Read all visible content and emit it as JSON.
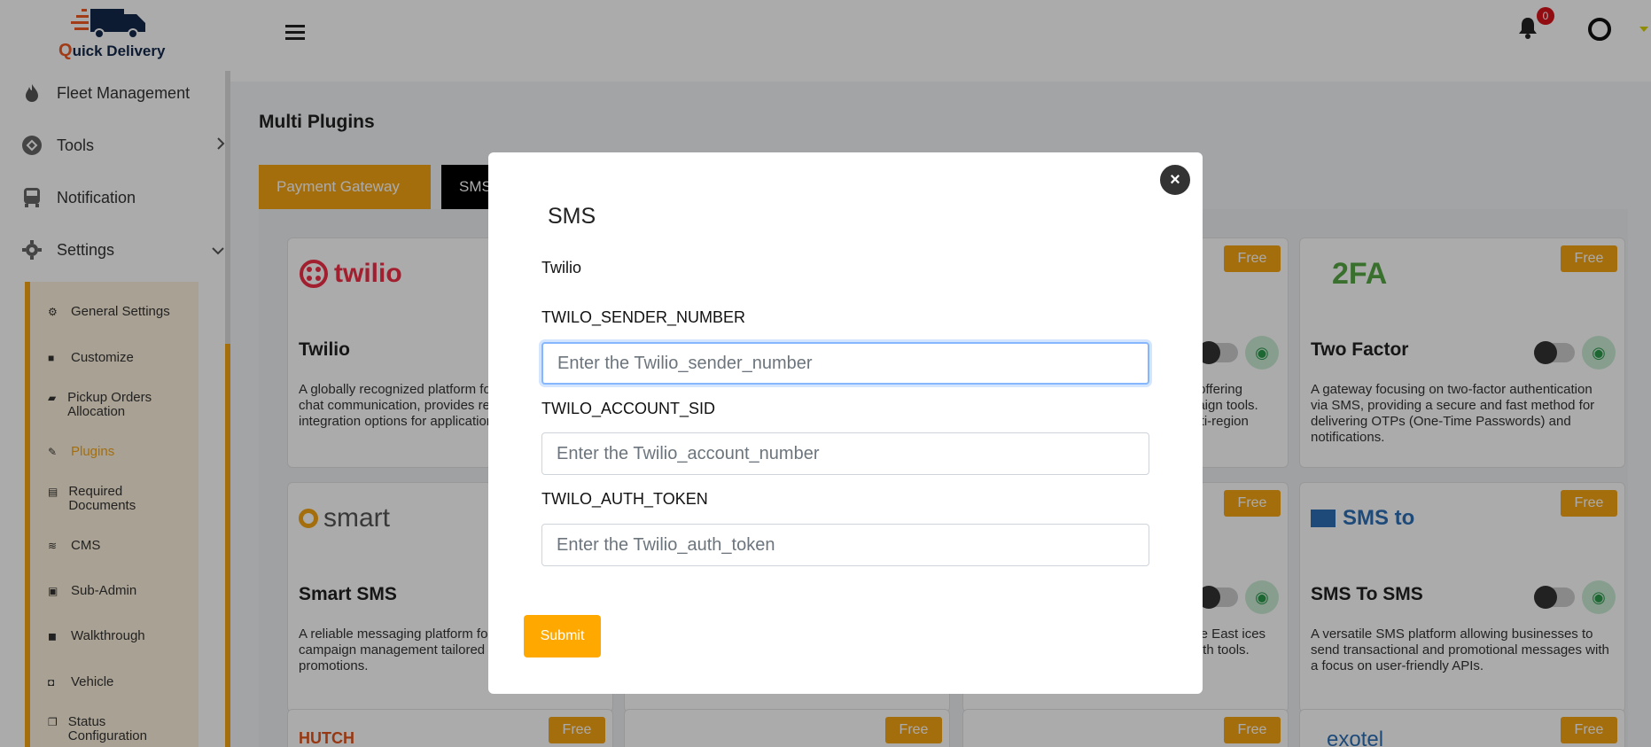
{
  "app": {
    "logo_name_initial": "Q",
    "logo_name_rest": "uick Delivery"
  },
  "sidebar": {
    "items": [
      {
        "label": "Fleet Management",
        "icon": "flame-icon"
      },
      {
        "label": "Tools",
        "icon": "tools-icon"
      },
      {
        "label": "Notification",
        "icon": "bus-icon"
      },
      {
        "label": "Settings",
        "icon": "gear-icon"
      }
    ],
    "submenu": [
      {
        "label": "General Settings",
        "icon": "gear-icon"
      },
      {
        "label": "Customize",
        "icon": "box-icon"
      },
      {
        "label": "Pickup Orders Allocation",
        "icon": "book-icon"
      },
      {
        "label": "Plugins",
        "icon": "plug-icon",
        "active": true
      },
      {
        "label": "Required Documents",
        "icon": "document-icon"
      },
      {
        "label": "CMS",
        "icon": "layers-icon"
      },
      {
        "label": "Sub-Admin",
        "icon": "id-card-icon"
      },
      {
        "label": "Walkthrough",
        "icon": "briefcase-icon"
      },
      {
        "label": "Vehicle",
        "icon": "bus-icon"
      },
      {
        "label": "Status Configuration",
        "icon": "copy-icon"
      }
    ]
  },
  "topbar": {
    "notification_count": "0"
  },
  "main": {
    "title": "Multi Plugins",
    "tabs": [
      {
        "label": "Payment Gateway"
      },
      {
        "label": "SMS"
      }
    ],
    "free_label": "Free",
    "cards": [
      {
        "brand": "twilio",
        "name": "Twilio",
        "desc": "A globally recognized platform for SMS, voice, and chat communication, provides reliable delivery and integration options for applications."
      },
      {
        "desc": "r offering paign tools. ulti-region"
      },
      {
        "brand": "2FA",
        "name": "Two Factor",
        "desc": "A gateway focusing on two-factor authentication via SMS, providing a secure and fast method for delivering OTPs (One-Time Passwords) and notifications."
      },
      {
        "brand": "smart",
        "name": "Smart SMS",
        "desc": "A reliable messaging platform for SMS and campaign management tailored for business promotions."
      },
      {
        "desc": "dle East ices with tools."
      },
      {
        "brand": "SMS to",
        "name": "SMS To SMS",
        "desc": "A versatile SMS platform allowing businesses to send transactional and promotional messages with a focus on user-friendly APIs."
      },
      {
        "brand": "HUTCH"
      },
      {
        "brand": "exotel"
      }
    ]
  },
  "modal": {
    "title": "SMS",
    "provider": "Twilio",
    "fields": [
      {
        "label": "TWILO_SENDER_NUMBER",
        "placeholder": "Enter the Twilio_sender_number"
      },
      {
        "label": "TWILO_ACCOUNT_SID",
        "placeholder": "Enter the Twilio_account_number"
      },
      {
        "label": "TWILO_AUTH_TOKEN",
        "placeholder": "Enter the Twilio_auth_token"
      }
    ],
    "submit_label": "Submit",
    "close_glyph": "×"
  },
  "colors": {
    "accent": "#f5a514",
    "submit": "#ffa800",
    "twilio": "#f22f46",
    "overlay": "rgba(0,0,0,0.33)"
  }
}
